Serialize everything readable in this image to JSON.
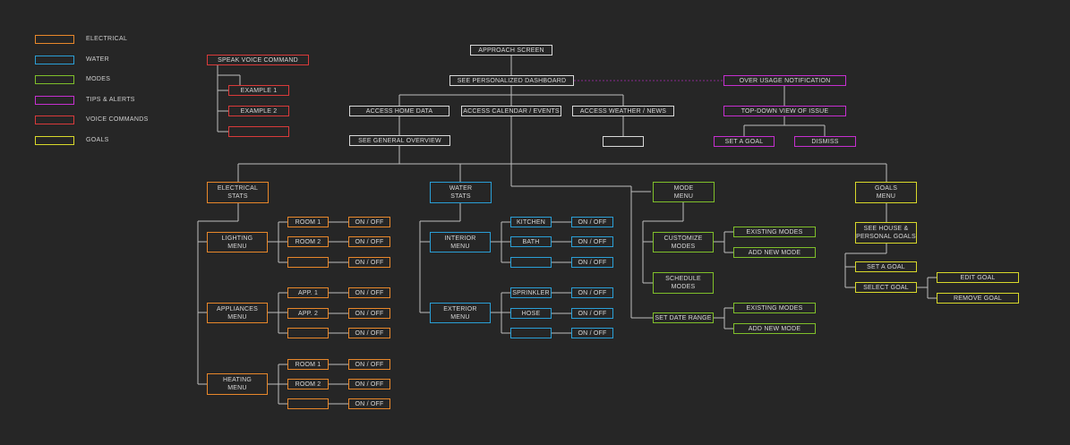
{
  "colors": {
    "background": "#262626",
    "white": "#d9d9d9",
    "electrical": "#e8872a",
    "water": "#2a9fd6",
    "modes": "#7fbf2a",
    "tips": "#c62fd0",
    "voice": "#d93a3a",
    "goals": "#d9d92a"
  },
  "legend": [
    {
      "label": "ELECTRICAL",
      "color": "#e8872a"
    },
    {
      "label": "WATER",
      "color": "#2a9fd6"
    },
    {
      "label": "MODES",
      "color": "#7fbf2a"
    },
    {
      "label": "TIPS & ALERTS",
      "color": "#c62fd0"
    },
    {
      "label": "VOICE COMMANDS",
      "color": "#d93a3a"
    },
    {
      "label": "GOALS",
      "color": "#d9d92a"
    }
  ],
  "nodes": {
    "approach": "APPROACH SCREEN",
    "dashboard": "SEE PERSONALIZED DASHBOARD",
    "home_data": "ACCESS HOME DATA",
    "calendar": "ACCESS CALENDAR / EVENTS",
    "weather": "ACCESS WEATHER / NEWS",
    "weather_blank": "",
    "overview": "SEE GENERAL OVERVIEW",
    "over_usage": "OVER USAGE NOTIFICATION",
    "top_down": "TOP-DOWN VIEW OF ISSUE",
    "set_goal_alert": "SET A GOAL",
    "dismiss": "DISMISS",
    "speak_voice": "SPEAK VOICE COMMAND",
    "example1": "EXAMPLE 1",
    "example2": "EXAMPLE 2",
    "example3": "",
    "elec_stats": "ELECTRICAL\nSTATS",
    "lighting_menu": "LIGHTING\nMENU",
    "appliances_menu": "APPLIANCES\nMENU",
    "heating_menu": "HEATING\nMENU",
    "light_room1": "ROOM 1",
    "light_room2": "ROOM 2",
    "light_room3": "",
    "app1": "APP. 1",
    "app2": "APP. 2",
    "app3": "",
    "heat_room1": "ROOM 1",
    "heat_room2": "ROOM 2",
    "heat_room3": "",
    "water_stats": "WATER\nSTATS",
    "interior_menu": "INTERIOR\nMENU",
    "exterior_menu": "EXTERIOR\nMENU",
    "kitchen": "KITCHEN",
    "bath": "BATH",
    "interior3": "",
    "sprinkler": "SPRINKLER",
    "hose": "HOSE",
    "exterior3": "",
    "mode_menu": "MODE\nMENU",
    "customize_modes": "CUSTOMIZE\nMODES",
    "schedule_modes": "SCHEDULE\nMODES",
    "set_date_range": "SET DATE RANGE",
    "existing_modes_1": "EXISTING MODES",
    "add_new_mode_1": "ADD NEW MODE",
    "existing_modes_2": "EXISTING MODES",
    "add_new_mode_2": "ADD NEW MODE",
    "goals_menu": "GOALS\nMENU",
    "see_house_goals": "SEE HOUSE &\nPERSONAL GOALS",
    "set_a_goal": "SET A GOAL",
    "select_goal": "SELECT GOAL",
    "edit_goal": "EDIT GOAL",
    "remove_goal": "REMOVE GOAL",
    "on_off": "ON / OFF"
  }
}
